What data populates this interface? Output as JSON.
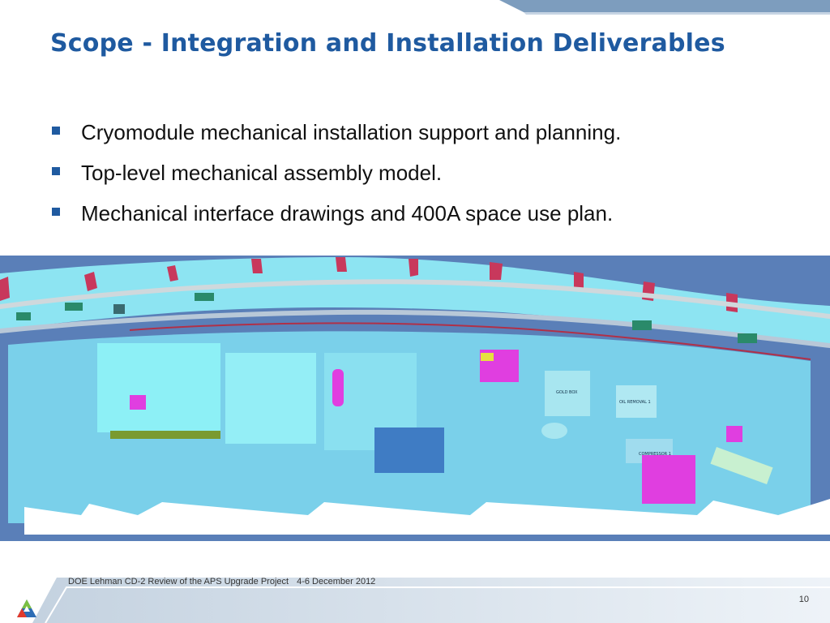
{
  "slide": {
    "title": "Scope - Integration and Installation Deliverables",
    "bullets": [
      "Cryomodule mechanical installation support and planning.",
      "Top-level mechanical assembly model.",
      "Mechanical interface drawings and 400A space use plan."
    ],
    "figure_labels": [
      "GOLD BOX",
      "OIL REMOVAL 1",
      "COMPRESSOR 1"
    ],
    "footer": {
      "event": "DOE Lehman CD-2 Review of the APS Upgrade Project",
      "date": "4-6 December  2012",
      "page_number": "10"
    }
  },
  "colors": {
    "title": "#1f5aa0",
    "bullet_marker": "#1f5aa0",
    "header_band": "#7d9dbe",
    "floor_cyan": "#9ee8f4",
    "wall_blue": "#5a7fb8",
    "equipment_magenta": "#e03ee0",
    "shield_red": "#c8385c"
  },
  "icons": {
    "logo": "argonne-triangle-logo"
  }
}
